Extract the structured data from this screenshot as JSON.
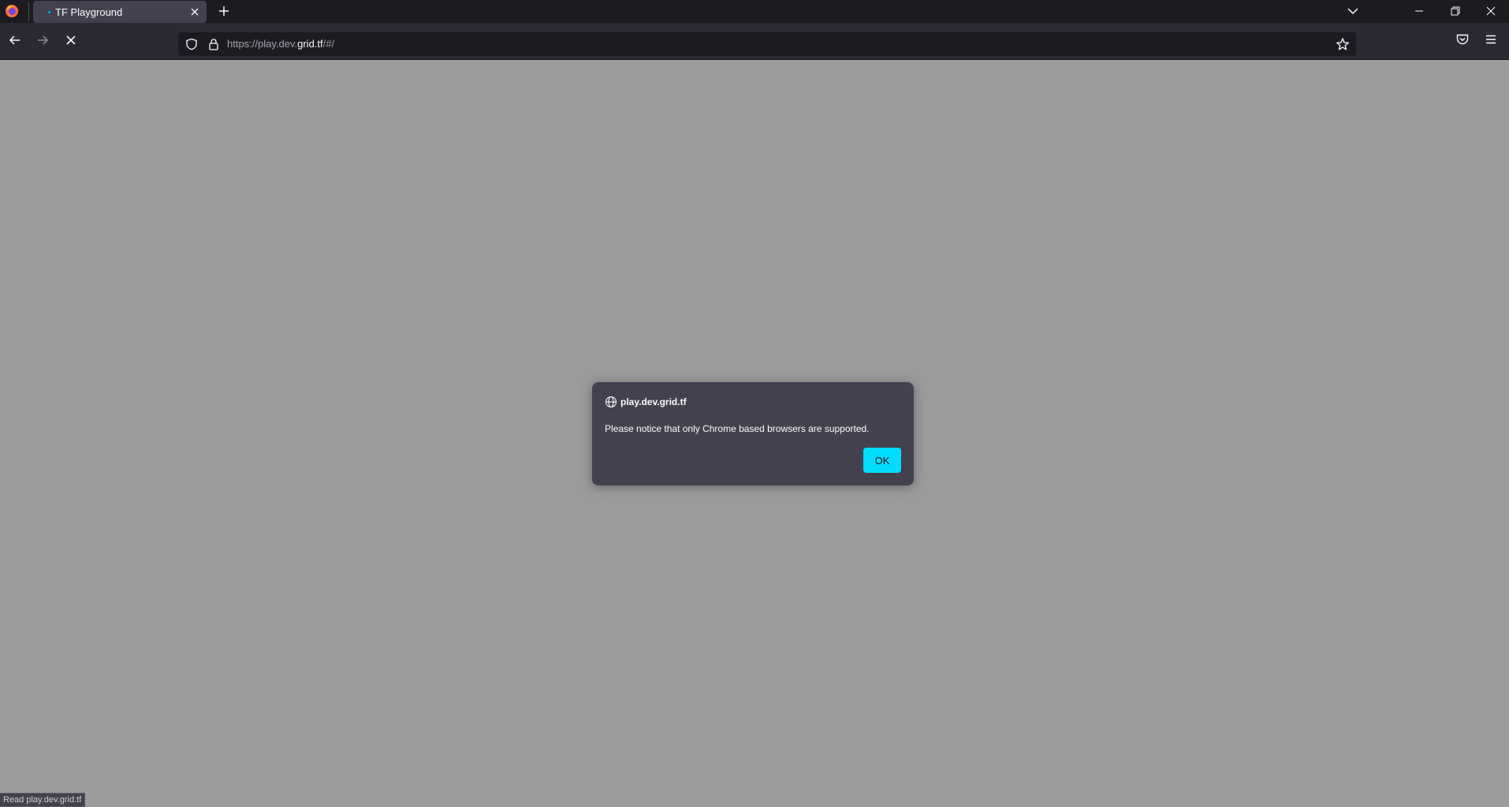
{
  "browser": {
    "tab": {
      "title": "TF Playground"
    },
    "url": {
      "prefix": "https://play.dev.",
      "domain": "grid.tf",
      "suffix": "/#/"
    },
    "accent_color": "#00ddff"
  },
  "icons": {
    "firefox": "firefox-logo-icon",
    "tab_close": "close-icon",
    "new_tab": "plus-icon",
    "list_all_tabs": "chevron-down-icon",
    "minimize": "minimize-icon",
    "restore": "restore-icon",
    "window_close": "close-icon",
    "back": "arrow-left-icon",
    "forward": "arrow-right-icon",
    "stop": "stop-icon",
    "tracking_protection": "shield-icon",
    "secure": "lock-icon",
    "bookmark": "star-icon",
    "pocket": "pocket-icon",
    "app_menu": "hamburger-menu-icon",
    "site": "globe-icon"
  },
  "dialog": {
    "origin": "play.dev.grid.tf",
    "message": "Please notice that only Chrome based browsers are supported.",
    "ok_label": "OK"
  },
  "status": {
    "text": "Read play.dev.grid.tf"
  }
}
